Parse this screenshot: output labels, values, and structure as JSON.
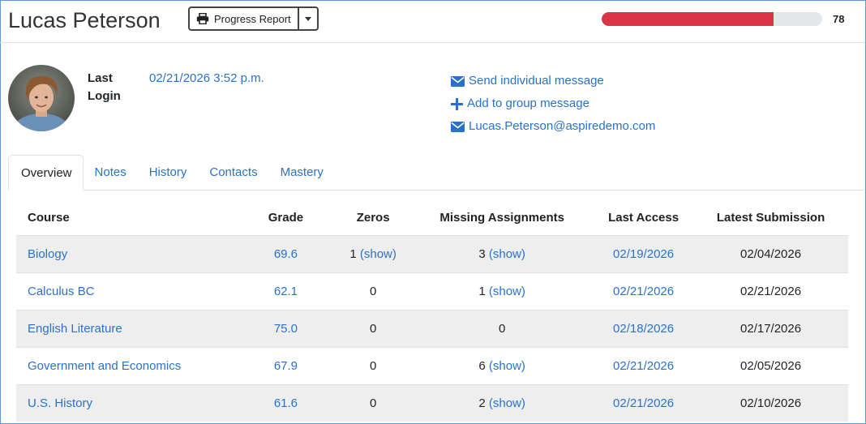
{
  "student": {
    "name": "Lucas Peterson",
    "progress_value": "78",
    "progress_fraction": 0.78,
    "last_login_label": "Last Login",
    "last_login_value": "02/21/2026 3:52 p.m."
  },
  "toolbar": {
    "progress_report_label": "Progress Report"
  },
  "actions": {
    "send_message": "Send individual message",
    "group_message": "Add to group message",
    "email": "Lucas.Peterson@aspiredemo.com"
  },
  "tabs": [
    {
      "label": "Overview"
    },
    {
      "label": "Notes"
    },
    {
      "label": "History"
    },
    {
      "label": "Contacts"
    },
    {
      "label": "Mastery"
    }
  ],
  "table": {
    "headers": {
      "course": "Course",
      "grade": "Grade",
      "zeros": "Zeros",
      "missing": "Missing Assignments",
      "last_access": "Last Access",
      "latest_submission": "Latest Submission"
    },
    "rows": [
      {
        "course": "Biology",
        "grade": "69.6",
        "zeros": "1",
        "zeros_show": "(show)",
        "missing": "3",
        "missing_show": "(show)",
        "last_access": "02/19/2026",
        "latest": "02/04/2026"
      },
      {
        "course": "Calculus BC",
        "grade": "62.1",
        "zeros": "0",
        "zeros_show": "",
        "missing": "1",
        "missing_show": "(show)",
        "last_access": "02/21/2026",
        "latest": "02/21/2026"
      },
      {
        "course": "English Literature",
        "grade": "75.0",
        "zeros": "0",
        "zeros_show": "",
        "missing": "0",
        "missing_show": "",
        "last_access": "02/18/2026",
        "latest": "02/17/2026"
      },
      {
        "course": "Government and Economics",
        "grade": "67.9",
        "zeros": "0",
        "zeros_show": "",
        "missing": "6",
        "missing_show": "(show)",
        "last_access": "02/21/2026",
        "latest": "02/05/2026"
      },
      {
        "course": "U.S. History",
        "grade": "61.6",
        "zeros": "0",
        "zeros_show": "",
        "missing": "2",
        "missing_show": "(show)",
        "last_access": "02/21/2026",
        "latest": "02/10/2026"
      }
    ]
  },
  "colors": {
    "link": "#2a72c9",
    "progress_fill": "#db3545",
    "row_stripe": "#eeeeee"
  },
  "icons": {
    "print": "print-icon",
    "caret": "chevron-down-icon",
    "envelope": "envelope-icon",
    "plus": "plus-icon"
  }
}
